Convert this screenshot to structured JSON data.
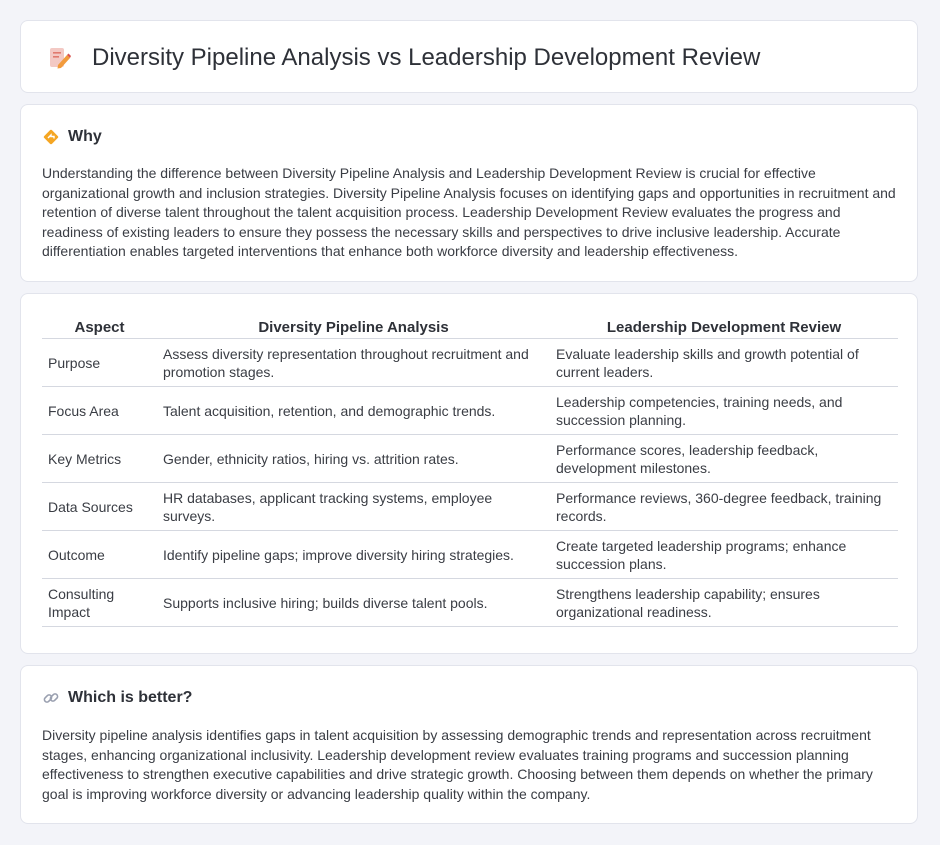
{
  "header": {
    "title": "Diversity Pipeline Analysis vs Leadership Development Review",
    "icon": "document-edit-icon"
  },
  "why": {
    "title": "Why",
    "icon": "diamond-sign-icon",
    "body": "Understanding the difference between Diversity Pipeline Analysis and Leadership Development Review is crucial for effective organizational growth and inclusion strategies. Diversity Pipeline Analysis focuses on identifying gaps and opportunities in recruitment and retention of diverse talent throughout the talent acquisition process. Leadership Development Review evaluates the progress and readiness of existing leaders to ensure they possess the necessary skills and perspectives to drive inclusive leadership. Accurate differentiation enables targeted interventions that enhance both workforce diversity and leadership effectiveness."
  },
  "comparison": {
    "headers": [
      "Aspect",
      "Diversity Pipeline Analysis",
      "Leadership Development Review"
    ],
    "rows": [
      {
        "aspect": "Purpose",
        "pipeline": "Assess diversity representation throughout recruitment and promotion stages.",
        "leadership": "Evaluate leadership skills and growth potential of current leaders."
      },
      {
        "aspect": "Focus Area",
        "pipeline": "Talent acquisition, retention, and demographic trends.",
        "leadership": "Leadership competencies, training needs, and succession planning."
      },
      {
        "aspect": "Key Metrics",
        "pipeline": "Gender, ethnicity ratios, hiring vs. attrition rates.",
        "leadership": "Performance scores, leadership feedback, development milestones."
      },
      {
        "aspect": "Data Sources",
        "pipeline": "HR databases, applicant tracking systems, employee surveys.",
        "leadership": "Performance reviews, 360-degree feedback, training records."
      },
      {
        "aspect": "Outcome",
        "pipeline": "Identify pipeline gaps; improve diversity hiring strategies.",
        "leadership": "Create targeted leadership programs; enhance succession plans."
      },
      {
        "aspect": "Consulting Impact",
        "pipeline": "Supports inclusive hiring; builds diverse talent pools.",
        "leadership": "Strengthens leadership capability; ensures organizational readiness."
      }
    ]
  },
  "better": {
    "title": "Which is better?",
    "icon": "link-icon",
    "body": "Diversity pipeline analysis identifies gaps in talent acquisition by assessing demographic trends and representation across recruitment stages, enhancing organizational inclusivity. Leadership development review evaluates training programs and succession planning effectiveness to strengthen executive capabilities and drive strategic growth. Choosing between them depends on whether the primary goal is improving workforce diversity or advancing leadership quality within the company."
  }
}
